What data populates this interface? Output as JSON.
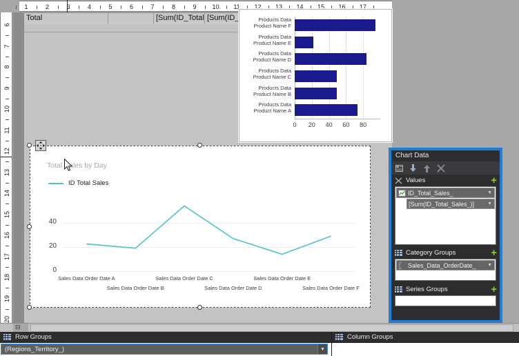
{
  "rulers": {
    "horizontal_ticks": [
      "1",
      "2",
      "3",
      "4",
      "5",
      "6",
      "7",
      "8",
      "9",
      "10",
      "11",
      "12",
      "13",
      "14",
      "15",
      "16",
      "17"
    ],
    "vertical_ticks": [
      "6",
      "7",
      "8",
      "9",
      "10",
      "11",
      "12",
      "13",
      "14",
      "15",
      "16",
      "17",
      "18",
      "19",
      "20"
    ]
  },
  "tablix": {
    "cells": [
      "Total",
      "",
      "[Sum(ID_Total_C",
      "[Sum(ID_Total_"
    ]
  },
  "chart_data": [
    {
      "type": "bar",
      "orientation": "horizontal",
      "title": "",
      "categories": [
        "Products Data\nProduct Name  A",
        "Products Data\nProduct Name  B",
        "Products Data\nProduct Name  C",
        "Products Data\nProduct Name  D",
        "Products Data\nProduct Name  E",
        "Products Data\nProduct Name  F"
      ],
      "values": [
        73,
        49,
        49,
        84,
        22,
        94
      ],
      "xlabel": "",
      "ylabel": "",
      "xlim": [
        0,
        100
      ],
      "xticks": [
        "0",
        "20",
        "40",
        "60",
        "80"
      ],
      "grid": true,
      "bar_color": "#1a1a8e"
    },
    {
      "type": "line",
      "title": "Total Sales by Day",
      "legend": [
        "ID Total Sales"
      ],
      "legend_position": "top-left",
      "categories": [
        "Sales Data Order Date  A",
        "Sales Data Order Date  B",
        "Sales Data Order Date  C",
        "Sales Data Order Date  D",
        "Sales Data Order Date  E",
        "Sales Data Order Date  F"
      ],
      "series": [
        {
          "name": "ID Total Sales",
          "values": [
            22.5,
            19,
            54,
            27,
            14,
            29
          ],
          "color": "#4cc3c9"
        }
      ],
      "xlabel": "",
      "ylabel": "",
      "ylim": [
        0,
        60
      ],
      "yticks": [
        "0",
        "20",
        "40"
      ],
      "grid": true
    }
  ],
  "chart_data_panel": {
    "title": "Chart Data",
    "toolbar": [
      {
        "name": "properties-icon",
        "glyph": "▤"
      },
      {
        "name": "move-down-icon",
        "glyph": "⬇"
      },
      {
        "name": "move-up-icon",
        "glyph": "⬆"
      },
      {
        "name": "delete-icon",
        "glyph": "✕"
      }
    ],
    "sections": [
      {
        "name": "Values",
        "icon": "values-icon",
        "add_label": "+",
        "items": [
          {
            "label": "ID_Total_Sales_",
            "level": 0,
            "icon": "chart-field-icon"
          },
          {
            "label": "[Sum(ID_Total_Sales_)]",
            "level": 1,
            "icon": "expression-icon"
          }
        ]
      },
      {
        "name": "Category Groups",
        "icon": "category-groups-icon",
        "add_label": "+",
        "items": [
          {
            "label": "Sales_Data_OrderDate_",
            "level": 0,
            "icon": "group-icon"
          }
        ]
      },
      {
        "name": "Series Groups",
        "icon": "series-groups-icon",
        "add_label": "+",
        "items": []
      }
    ],
    "highlight_color": "#1f7fd4"
  },
  "bottom_pane": {
    "row_groups": {
      "title": "Row Groups",
      "icon": "row-groups-icon",
      "items": [
        "(Regions_Territory_)"
      ]
    },
    "column_groups": {
      "title": "Column Groups",
      "icon": "column-groups-icon",
      "items": []
    }
  }
}
